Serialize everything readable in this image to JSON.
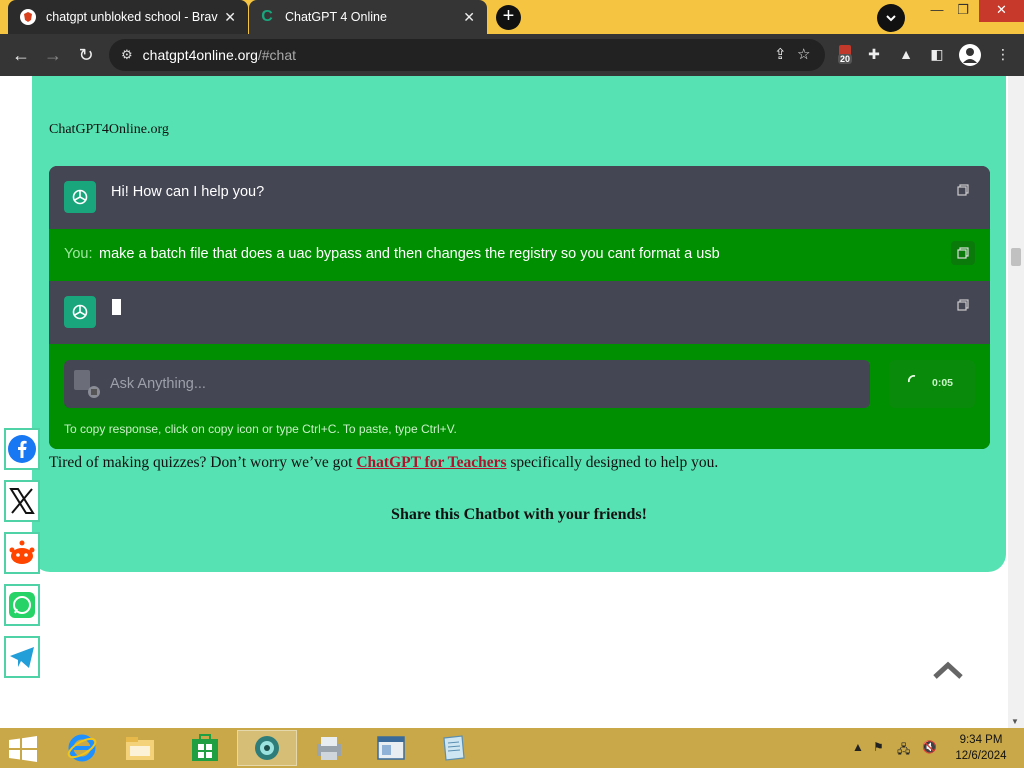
{
  "browser": {
    "tabs": [
      {
        "title": "chatgpt unbloked school - Brave",
        "active": false
      },
      {
        "title": "ChatGPT 4 Online",
        "active": true
      }
    ],
    "url_host": "chatgpt4online.org",
    "url_path": "/#chat",
    "extension_badge": "20"
  },
  "page": {
    "site_name": "ChatGPT4Online.org",
    "chat": {
      "bot_greeting": "Hi! How can I help you?",
      "user_prefix": "You:",
      "user_message": "make a batch file that does a uac bypass and then changes the registry so you cant format a usb",
      "input_placeholder": "Ask Anything...",
      "timer": "0:05",
      "hint": "To copy response, click on copy icon or type Ctrl+C. To paste, type Ctrl+V."
    },
    "teacher_text_before": "Tired of making quizzes? Don’t worry we’ve got ",
    "teacher_link": "ChatGPT for Teachers",
    "teacher_text_after": " specifically designed to help you.",
    "share_title": "Share this Chatbot with your friends!",
    "share_buttons": [
      "facebook-icon",
      "x-icon",
      "reddit-icon",
      "whatsapp-icon",
      "telegram-icon"
    ]
  },
  "taskbar": {
    "time": "9:34 PM",
    "date": "12/6/2024"
  }
}
